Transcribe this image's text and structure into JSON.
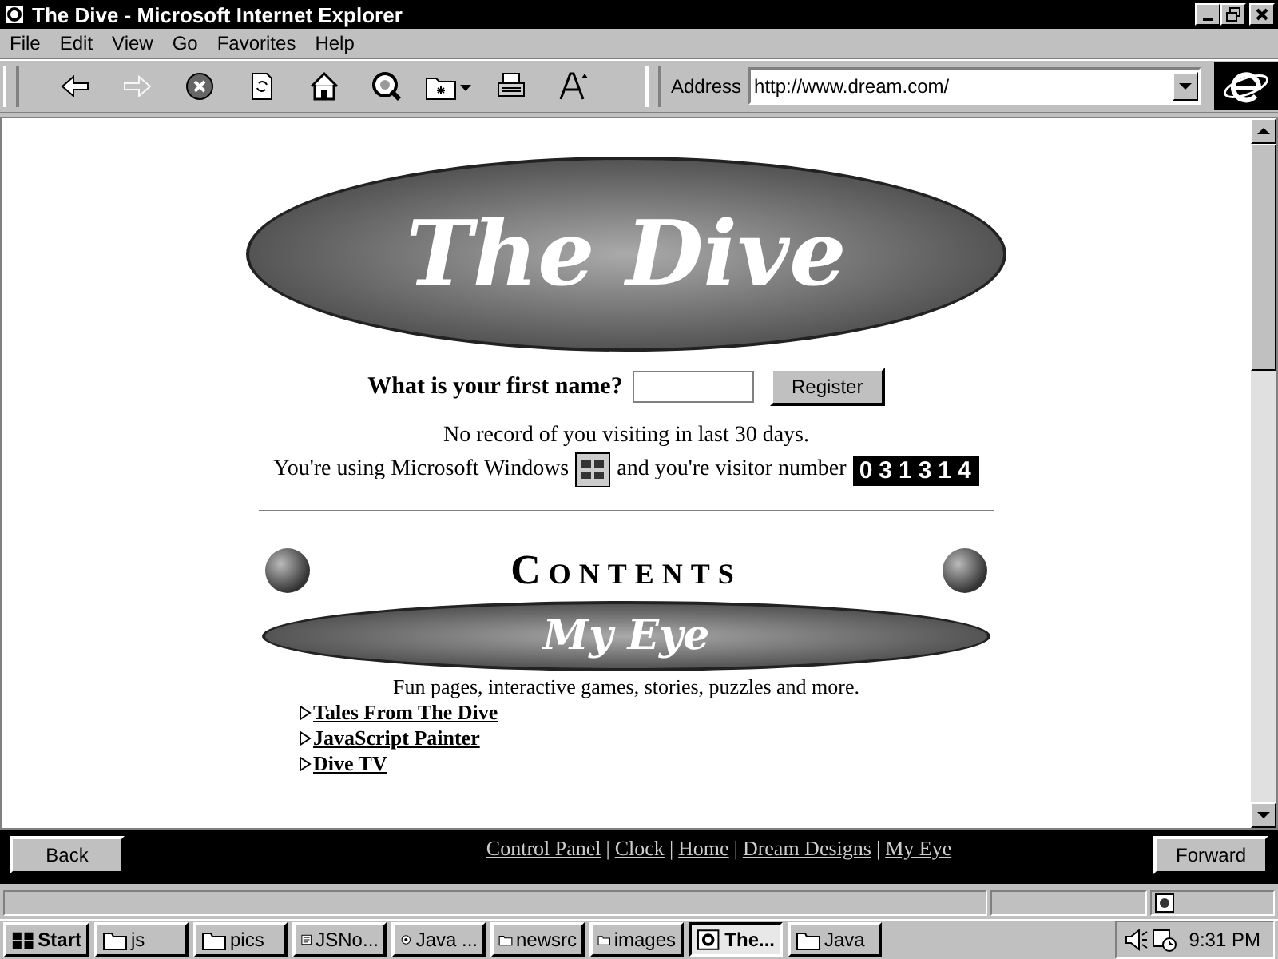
{
  "window": {
    "title": "The Dive - Microsoft Internet Explorer"
  },
  "menu": [
    "File",
    "Edit",
    "View",
    "Go",
    "Favorites",
    "Help"
  ],
  "toolbar": [
    {
      "kind": "back",
      "disabled": false
    },
    {
      "kind": "forward",
      "disabled": true
    },
    {
      "kind": "stop",
      "disabled": false
    },
    {
      "kind": "refresh",
      "disabled": false
    },
    {
      "kind": "home",
      "disabled": false
    },
    {
      "kind": "search",
      "disabled": false
    },
    {
      "kind": "favorites",
      "disabled": false
    },
    {
      "kind": "print",
      "disabled": false
    },
    {
      "kind": "font",
      "disabled": false
    }
  ],
  "address": {
    "label": "Address",
    "value": "http://www.dream.com/"
  },
  "page": {
    "logo": "The Dive",
    "question": "What is your first name?",
    "register": "Register",
    "record": "No record of you visiting in last 30 days.",
    "os_text": "You're using Microsoft Windows",
    "visitor_text": "and you're visitor number",
    "visitor_number": "031314",
    "contents": "Contents",
    "banner": "My Eye",
    "description": "Fun pages, interactive games, stories, puzzles and more.",
    "links": [
      "Tales From The Dive",
      "JavaScript Painter",
      "Dive TV"
    ]
  },
  "footer": {
    "back": "Back",
    "forward": "Forward",
    "separator": "|",
    "links": [
      "Control Panel",
      "Clock",
      "Home",
      "Dream Designs",
      "My Eye"
    ]
  },
  "taskbar": {
    "start": "Start",
    "items": [
      {
        "kind": "folder",
        "label": "js",
        "selected": false
      },
      {
        "kind": "folder",
        "label": "pics",
        "selected": false
      },
      {
        "kind": "notepad",
        "label": "JSNo...",
        "selected": false
      },
      {
        "kind": "java",
        "label": "Java ...",
        "selected": false
      },
      {
        "kind": "folder",
        "label": "newsrc",
        "selected": false
      },
      {
        "kind": "folder",
        "label": "images",
        "selected": false
      },
      {
        "kind": "browser",
        "label": "The...",
        "selected": true
      },
      {
        "kind": "folder",
        "label": "Java",
        "selected": false
      }
    ],
    "clock": "9:31 PM"
  }
}
